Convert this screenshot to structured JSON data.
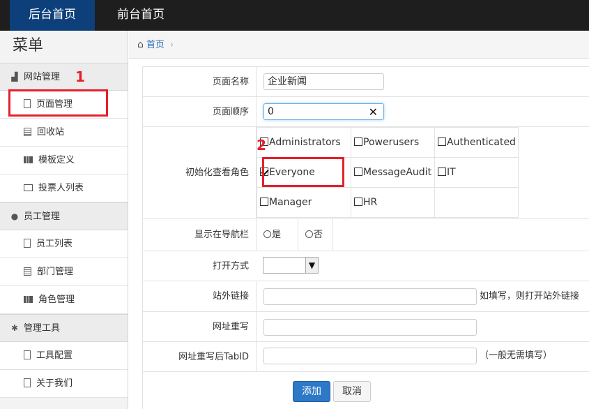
{
  "topnav": {
    "tabs": [
      {
        "label": "后台首页"
      },
      {
        "label": "前台首页"
      }
    ]
  },
  "sidebar": {
    "title": "菜单",
    "groups": [
      {
        "label": "网站管理",
        "items": [
          {
            "label": "页面管理"
          },
          {
            "label": "回收站"
          },
          {
            "label": "模板定义"
          },
          {
            "label": "投票人列表"
          }
        ]
      },
      {
        "label": "员工管理",
        "items": [
          {
            "label": "员工列表"
          },
          {
            "label": "部门管理"
          },
          {
            "label": "角色管理"
          }
        ]
      },
      {
        "label": "管理工具",
        "items": [
          {
            "label": "工具配置"
          },
          {
            "label": "关于我们"
          }
        ]
      }
    ]
  },
  "annotations": {
    "box1": "1",
    "box2": "2"
  },
  "breadcrumb": {
    "home": "首页"
  },
  "form": {
    "page_name": {
      "label": "页面名称",
      "value": "企业新闻"
    },
    "page_order": {
      "label": "页面顺序",
      "value": "0"
    },
    "roles": {
      "label": "初始化查看角色",
      "options": [
        {
          "name": "Administrators",
          "checked": false
        },
        {
          "name": "Powerusers",
          "checked": false
        },
        {
          "name": "Authenticated",
          "checked": false
        },
        {
          "name": "Everyone",
          "checked": true
        },
        {
          "name": "MessageAudit",
          "checked": false
        },
        {
          "name": "IT",
          "checked": false
        },
        {
          "name": "Manager",
          "checked": false
        },
        {
          "name": "HR",
          "checked": false
        }
      ]
    },
    "show_in_nav": {
      "label": "显示在导航栏",
      "yes": "是",
      "no": "否"
    },
    "open_mode": {
      "label": "打开方式",
      "value": ""
    },
    "external_link": {
      "label": "站外链接",
      "value": "",
      "hint": "如填写，则打开站外链接"
    },
    "url_rewrite": {
      "label": "网址重写",
      "value": ""
    },
    "rewrite_tabid": {
      "label": "网址重写后TabID",
      "value": "",
      "hint": "（一般无需填写）"
    },
    "submit_label": "添加",
    "cancel_label": "取消"
  },
  "colors": {
    "accent": "#2e79c7",
    "nav_bg": "#1e1e1e",
    "nav_active": "#0d3f7a",
    "annotation": "#e4202a"
  }
}
